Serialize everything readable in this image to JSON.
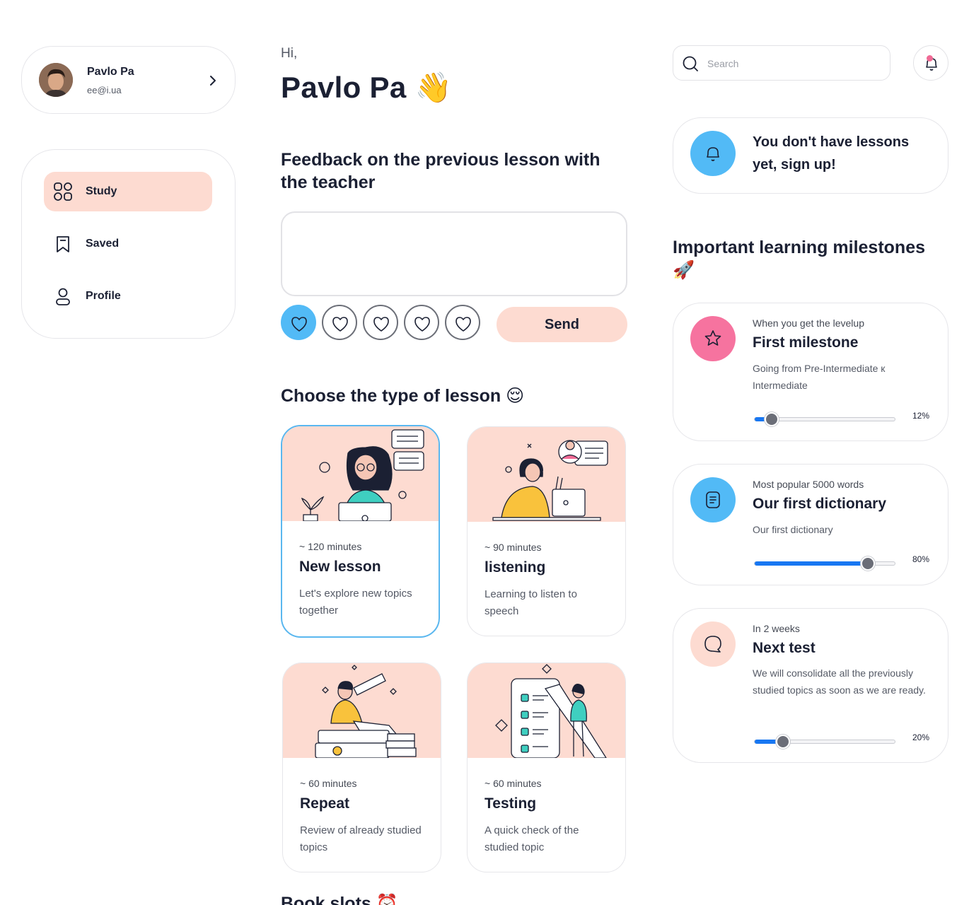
{
  "profile": {
    "name": "Pavlo Pa",
    "email": "ee@i.ua"
  },
  "nav": [
    {
      "label": "Study",
      "icon": "grid-icon",
      "active": true
    },
    {
      "label": "Saved",
      "icon": "bookmark-icon",
      "active": false
    },
    {
      "label": "Profile",
      "icon": "user-icon",
      "active": false
    }
  ],
  "greeting": {
    "hi": "Hi,",
    "name": "Pavlo Pa 👋"
  },
  "feedback": {
    "title": "Feedback on the previous lesson with the teacher",
    "value": "",
    "rating_selected": 1,
    "rating_max": 5,
    "send_label": "Send"
  },
  "lessons": {
    "title": "Choose the type of lesson 😌",
    "items": [
      {
        "duration": "~ 120 minutes",
        "title": "New lesson",
        "desc": "Let's explore new topics together",
        "selected": true
      },
      {
        "duration": "~ 90 minutes",
        "title": "listening",
        "desc": "Learning to listen to speech",
        "selected": false
      },
      {
        "duration": "~ 60 minutes",
        "title": "Repeat",
        "desc": "Review of already studied topics",
        "selected": false
      },
      {
        "duration": "~ 60 minutes",
        "title": "Testing",
        "desc": "A quick check of the studied topic",
        "selected": false
      }
    ]
  },
  "book_slots": {
    "title": "Book slots ⏰"
  },
  "search": {
    "placeholder": "Search",
    "value": ""
  },
  "notice": {
    "text": "You don't have lessons yet, sign up!",
    "color": "#52baf6"
  },
  "milestones": {
    "title": "Important learning milestones 🚀",
    "items": [
      {
        "subtitle": "When you get the levelup",
        "title": "First milestone",
        "desc": "Going from Pre-Intermediate к Intermediate",
        "progress": 12,
        "progress_label": "12%",
        "icon": "star-icon",
        "color": "#f6739f"
      },
      {
        "subtitle": "Most popular 5000 words",
        "title": "Our first dictionary",
        "desc": "Our first dictionary",
        "progress": 80,
        "progress_label": "80%",
        "icon": "document-icon",
        "color": "#52baf6"
      },
      {
        "subtitle": "In 2 weeks",
        "title": "Next test",
        "desc": "We will consolidate all the previously studied topics as soon as we are ready.",
        "progress": 20,
        "progress_label": "20%",
        "icon": "chat-icon",
        "color": "#fddbd1"
      }
    ]
  },
  "colors": {
    "accent_pink": "#fddbd1",
    "accent_blue": "#52baf6",
    "progress_blue": "#1877f2",
    "text": "#1b2033"
  }
}
